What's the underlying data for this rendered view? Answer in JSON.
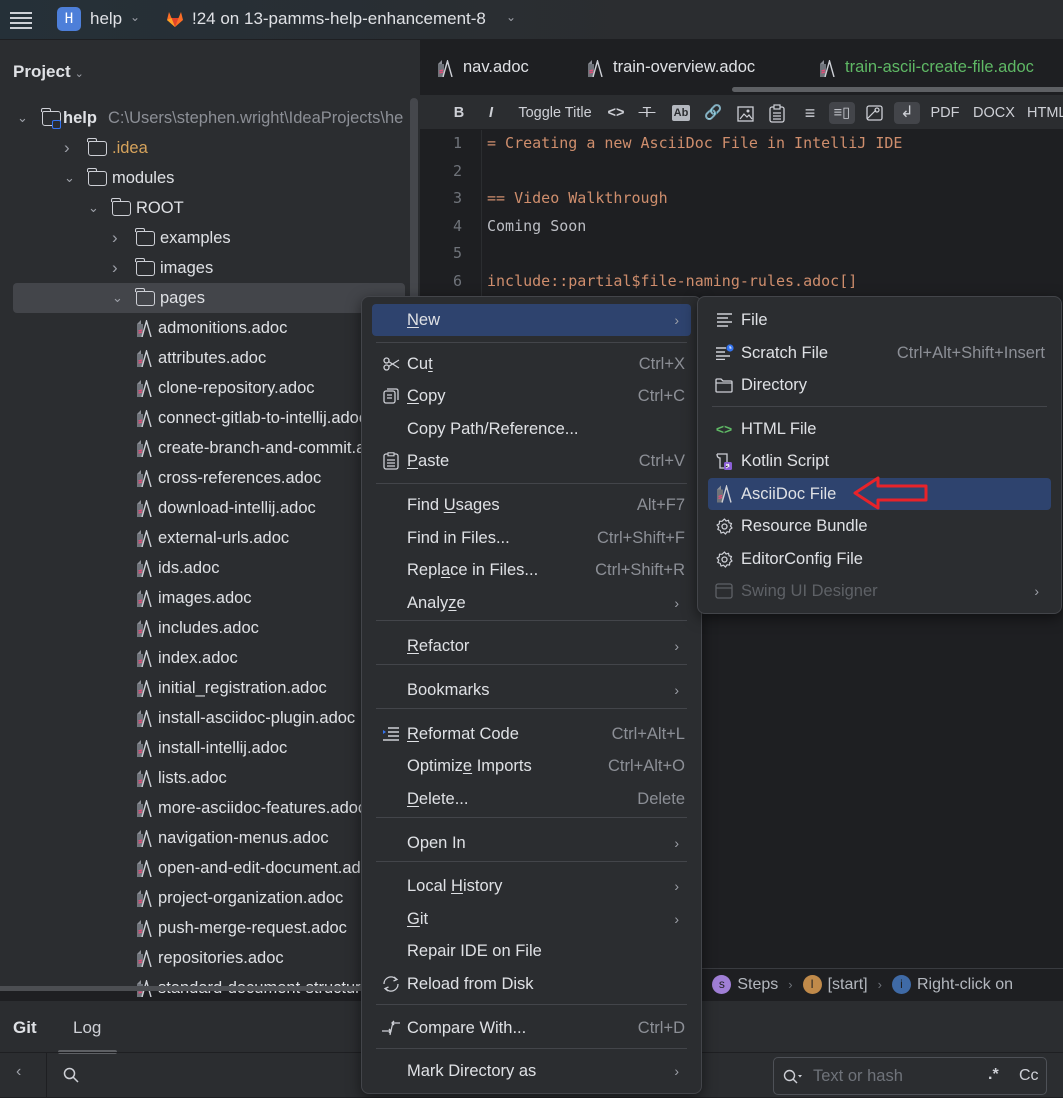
{
  "titlebar": {
    "project_badge": "H",
    "project_name": "help",
    "branch": "!24 on 13-pamms-help-enhancement-8"
  },
  "project_pane": {
    "header": "Project",
    "root": {
      "name": "help",
      "path": "C:\\Users\\stephen.wright\\IdeaProjects\\he"
    },
    "folders": [
      {
        "name": ".idea",
        "expanded": false
      },
      {
        "name": "modules",
        "expanded": true
      },
      {
        "name": "ROOT",
        "expanded": true
      },
      {
        "name": "examples",
        "expanded": false
      },
      {
        "name": "images",
        "expanded": false
      },
      {
        "name": "pages",
        "expanded": true,
        "selected": true
      }
    ],
    "files": [
      "admonitions.adoc",
      "attributes.adoc",
      "clone-repository.adoc",
      "connect-gitlab-to-intellij.adoc",
      "create-branch-and-commit.adoc",
      "cross-references.adoc",
      "download-intellij.adoc",
      "external-urls.adoc",
      "ids.adoc",
      "images.adoc",
      "includes.adoc",
      "index.adoc",
      "initial_registration.adoc",
      "install-asciidoc-plugin.adoc",
      "install-intellij.adoc",
      "lists.adoc",
      "more-asciidoc-features.adoc",
      "navigation-menus.adoc",
      "open-and-edit-document.adoc",
      "project-organization.adoc",
      "push-merge-request.adoc",
      "repositories.adoc",
      "standard-document-structure.adoc"
    ]
  },
  "editor": {
    "tabs": [
      {
        "label": "nav.adoc",
        "active": false
      },
      {
        "label": "train-overview.adoc",
        "active": false
      },
      {
        "label": "train-ascii-create-file.adoc",
        "active": true
      }
    ],
    "toolbar": {
      "bold": "B",
      "italic": "I",
      "toggle_title": "Toggle Title",
      "pdf": "PDF",
      "docx": "DOCX",
      "html": "HTML"
    },
    "lines": [
      {
        "n": "1",
        "text": "= Creating a new AsciiDoc File in IntelliJ IDE",
        "kind": "title"
      },
      {
        "n": "2",
        "text": "",
        "kind": "plain"
      },
      {
        "n": "3",
        "text": "== Video Walkthrough",
        "kind": "title"
      },
      {
        "n": "4",
        "text": "Coming Soon",
        "kind": "plain"
      },
      {
        "n": "5",
        "text": "",
        "kind": "plain"
      },
      {
        "n": "6",
        "text": "include::partial$file-naming-rules.adoc[]",
        "kind": "include"
      }
    ],
    "breadcrumb": [
      {
        "badge": "s",
        "label": "Steps",
        "color": "#a07fd6"
      },
      {
        "badge": "l",
        "label": "[start]",
        "color": "#c08a4a"
      },
      {
        "badge": "i",
        "label": "Right-click on",
        "color": "#3f6aa6"
      }
    ]
  },
  "context_menu": {
    "items": [
      {
        "label": "New",
        "shortcut": "",
        "submenu": true,
        "highlighted": true
      },
      {
        "label": "Cut",
        "shortcut": "Ctrl+X",
        "icon": "scissors"
      },
      {
        "label": "Copy",
        "shortcut": "Ctrl+C",
        "icon": "copy"
      },
      {
        "label": "Copy Path/Reference...",
        "shortcut": ""
      },
      {
        "label": "Paste",
        "shortcut": "Ctrl+V",
        "icon": "paste"
      },
      {
        "label": "Find Usages",
        "shortcut": "Alt+F7"
      },
      {
        "label": "Find in Files...",
        "shortcut": "Ctrl+Shift+F"
      },
      {
        "label": "Replace in Files...",
        "shortcut": "Ctrl+Shift+R"
      },
      {
        "label": "Analyze",
        "submenu": true
      },
      {
        "label": "Refactor",
        "submenu": true
      },
      {
        "label": "Bookmarks",
        "submenu": true
      },
      {
        "label": "Reformat Code",
        "shortcut": "Ctrl+Alt+L",
        "icon": "reformat"
      },
      {
        "label": "Optimize Imports",
        "shortcut": "Ctrl+Alt+O"
      },
      {
        "label": "Delete...",
        "shortcut": "Delete"
      },
      {
        "label": "Open In",
        "submenu": true
      },
      {
        "label": "Local History",
        "submenu": true
      },
      {
        "label": "Git",
        "submenu": true
      },
      {
        "label": "Repair IDE on File",
        "shortcut": ""
      },
      {
        "label": "Reload from Disk",
        "icon": "reload"
      },
      {
        "label": "Compare With...",
        "shortcut": "Ctrl+D",
        "icon": "compare"
      },
      {
        "label": "Mark Directory as",
        "submenu": true
      }
    ]
  },
  "new_submenu": {
    "items": [
      {
        "label": "File",
        "icon": "file"
      },
      {
        "label": "Scratch File",
        "shortcut": "Ctrl+Alt+Shift+Insert",
        "icon": "scratch"
      },
      {
        "label": "Directory",
        "icon": "folder"
      },
      {
        "label": "HTML File",
        "icon": "html"
      },
      {
        "label": "Kotlin Script",
        "icon": "kotlin"
      },
      {
        "label": "AsciiDoc File",
        "icon": "asciidoc",
        "highlighted": true
      },
      {
        "label": "Resource Bundle",
        "icon": "gear"
      },
      {
        "label": "EditorConfig File",
        "icon": "gear"
      },
      {
        "label": "Swing UI Designer",
        "icon": "window",
        "disabled": true,
        "submenu": true
      }
    ]
  },
  "bottom_panel": {
    "tabs": [
      "Git",
      "Log"
    ],
    "active_tab": "Log",
    "search_placeholder": "Text or hash",
    "regex_toggle": ".*",
    "case_toggle": "Cc"
  },
  "colors": {
    "accent_highlight": "#2e436e",
    "active_tab_text": "#5fb865",
    "annotation_arrow": "#e8232a"
  }
}
